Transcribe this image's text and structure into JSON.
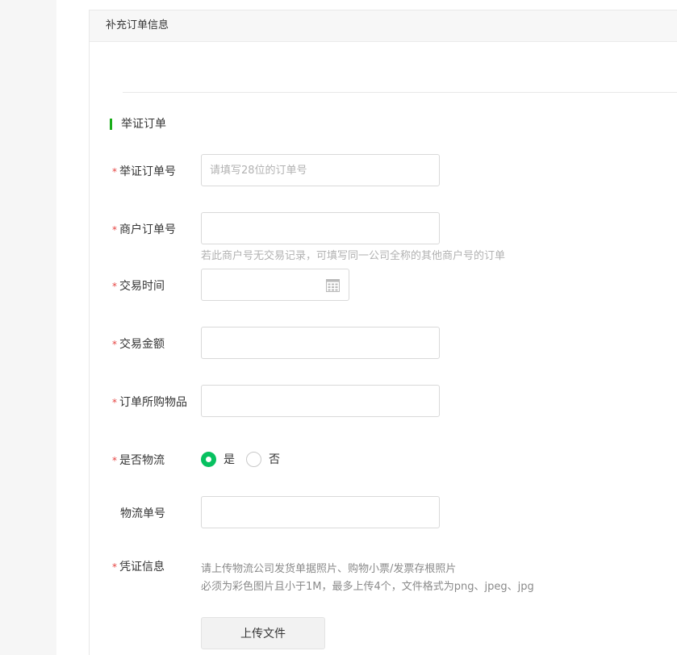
{
  "card": {
    "header_title": "补充订单信息"
  },
  "section": {
    "title": "举证订单"
  },
  "required_mark": "*",
  "fields": {
    "order_no": {
      "label": "举证订单号",
      "placeholder": "请填写28位的订单号",
      "value": ""
    },
    "merchant_order_no": {
      "label": "商户订单号",
      "value": "",
      "hint": "若此商户号无交易记录，可填写同一公司全称的其他商户号的订单"
    },
    "trade_time": {
      "label": "交易时间",
      "value": "",
      "icon": "calendar-icon"
    },
    "trade_amount": {
      "label": "交易金额",
      "value": ""
    },
    "items": {
      "label": "订单所购物品",
      "value": ""
    },
    "logistics": {
      "label": "是否物流",
      "options": [
        "是",
        "否"
      ],
      "selected": "是"
    },
    "logistics_no": {
      "label": "物流单号",
      "value": ""
    },
    "voucher": {
      "label": "凭证信息",
      "desc_line1": "请上传物流公司发货单据照片、购物小票/发票存根照片",
      "desc_line2": "必须为彩色图片且小于1M，最多上传4个，文件格式为png、jpeg、jpg",
      "upload_label": "上传文件"
    }
  },
  "colors": {
    "accent": "#07c160",
    "section_bar": "#1aad19",
    "required": "#e64340",
    "placeholder": "#b2b2b2"
  }
}
